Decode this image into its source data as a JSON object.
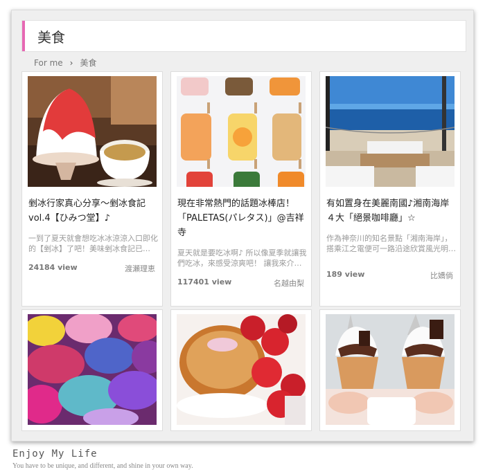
{
  "page": {
    "title": "美食",
    "accent_color": "#e668b3"
  },
  "breadcrumb": {
    "home": "For me",
    "separator": "›",
    "current": "美食"
  },
  "cards": [
    {
      "title": "剉冰行家真心分享～剉冰食記vol.4【ひみつ堂】♪",
      "desc": "一到了夏天就會想吃冰冰涼涼入口即化的【剉冰】了吧！美味剉冰食記已…",
      "views": "24184 view",
      "author": "渡瀬理恵"
    },
    {
      "title": "現在非常熱門的話題冰棒店！「PALETAS(パレタス)」@吉祥寺",
      "desc": "夏天就是要吃冰啊♪ 所以像夏季就讓我們吃冰，來感受涼爽吧！ 讓我來介…",
      "views": "117401 view",
      "author": "名越由梨"
    },
    {
      "title": "有如置身在美麗南國♪湘南海岸４大「絕景咖啡廳」☆",
      "desc": "作為神奈川的知名景點「湘南海岸」，搭乘江之電便可一路沿途欣賞風光明…",
      "views": "189 view",
      "author": "比嬌倘"
    },
    {
      "title": "",
      "desc": "",
      "views": "",
      "author": ""
    },
    {
      "title": "",
      "desc": "",
      "views": "",
      "author": ""
    },
    {
      "title": "",
      "desc": "",
      "views": "",
      "author": ""
    }
  ],
  "footer": {
    "signature": "Enjoy My Life",
    "tagline": "You have to be unique, and different, and shine in your own way."
  }
}
